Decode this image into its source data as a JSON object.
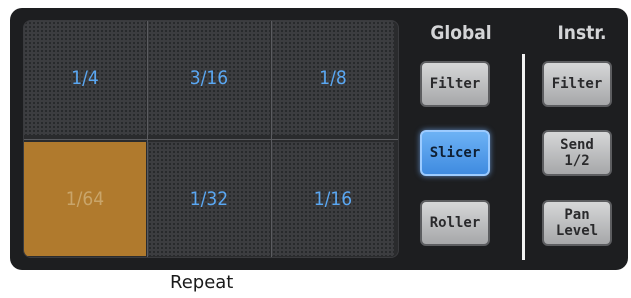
{
  "repeat": {
    "pads": [
      {
        "label": "1/4",
        "active": false
      },
      {
        "label": "3/16",
        "active": false
      },
      {
        "label": "1/8",
        "active": false
      },
      {
        "label": "1/64",
        "active": true
      },
      {
        "label": "1/32",
        "active": false
      },
      {
        "label": "1/16",
        "active": false
      }
    ],
    "caption": "Repeat"
  },
  "global": {
    "title": "Global",
    "buttons": [
      {
        "label": "Filter",
        "active": false
      },
      {
        "label": "Slicer",
        "active": true
      },
      {
        "label": "Roller",
        "active": false
      }
    ]
  },
  "instr": {
    "title": "Instr.",
    "buttons": [
      {
        "label": "Filter"
      },
      {
        "label": "Send\n1/2"
      },
      {
        "label": "Pan\nLevel"
      }
    ]
  },
  "colors": {
    "pad_active": "#b07a2d",
    "pad_text": "#5aa7f2",
    "button_active": "#4a97e8",
    "panel": "#1d1e20"
  }
}
